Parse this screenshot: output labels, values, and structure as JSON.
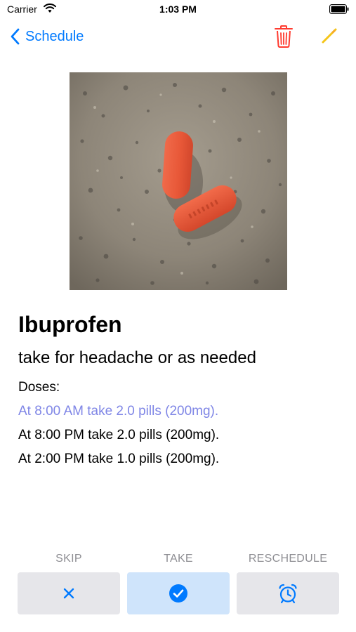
{
  "status_bar": {
    "carrier": "Carrier",
    "time": "1:03 PM"
  },
  "nav": {
    "back_label": "Schedule",
    "accent_color": "#007aff",
    "icons": [
      "chevron-left-icon",
      "trash-icon",
      "pencil-icon"
    ]
  },
  "medication": {
    "name": "Ibuprofen",
    "note": "take for headache or as needed",
    "doses_heading": "Doses:",
    "doses": [
      {
        "text": "At 8:00 AM take 2.0 pills (200mg).",
        "highlighted": true
      },
      {
        "text": "At 8:00 PM take 2.0 pills (200mg).",
        "highlighted": false
      },
      {
        "text": "At 2:00 PM take 1.0 pills (200mg).",
        "highlighted": false
      }
    ]
  },
  "actions": {
    "skip": {
      "label": "SKIP",
      "icon": "close-icon"
    },
    "take": {
      "label": "TAKE",
      "icon": "checkmark-circle-icon"
    },
    "reschedule": {
      "label": "RESCHEDULE",
      "icon": "alarm-clock-icon"
    }
  },
  "colors": {
    "trash": "#ff3b30",
    "pencil": "#f5c518",
    "highlight_dose": "#7f86e6",
    "take_button_bg": "#cfe4fb"
  }
}
